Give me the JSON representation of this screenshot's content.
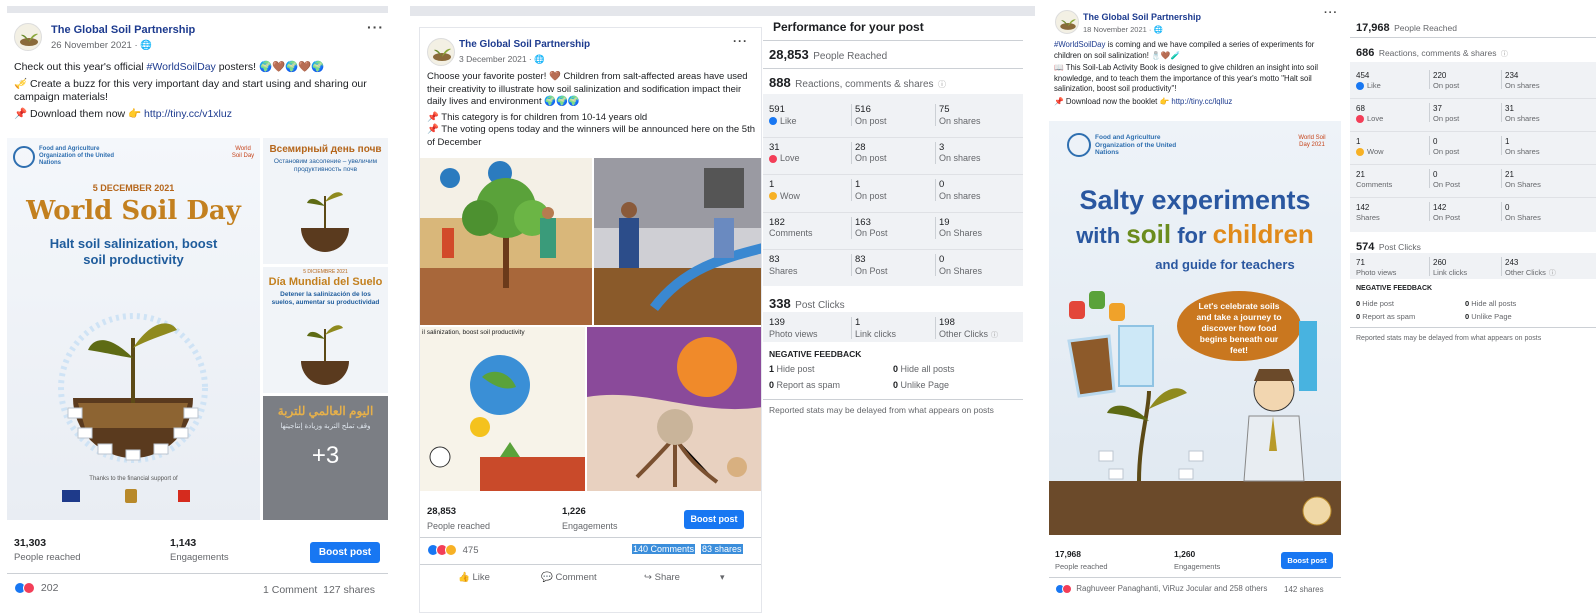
{
  "post1": {
    "page_name": "The Global Soil Partnership",
    "date": "26 November 2021 · ",
    "line1a": "Check out this year's official ",
    "line1b": "#WorldSoilDay",
    "line1c": " posters! 🌍🤎🌍🤎🌍",
    "line2": "🎺 Create a buzz for this very important day and start using and sharing our campaign materials!",
    "line3a": "📌 Download them now 👉 ",
    "line3b": "http://tiny.cc/v1xluz",
    "poster_main": {
      "org": "Food and Agriculture Organization of the United Nations",
      "date": "5 DECEMBER 2021",
      "title": "World Soil Day",
      "subtitle": "Halt soil salinization, boost soil productivity",
      "badge": "World Soil Day",
      "footer": "Thanks to the financial support of"
    },
    "poster_ru": {
      "title": "Всемирный день почв",
      "sub": "Остановим засоление – увеличим продуктивность почв"
    },
    "poster_es": {
      "date": "5 DICIEMBRE 2021",
      "title": "Día Mundial del Suelo",
      "sub": "Detener la salinización de los suelos, aumentar su productividad"
    },
    "poster_ar": {
      "title": "اليوم العالمي للتربة",
      "sub": "وقف تملح التربة وزيادة إنتاجيتها",
      "more": "+3"
    },
    "reached_num": "31,303",
    "reached_lab": "People reached",
    "eng_num": "1,143",
    "eng_lab": "Engagements",
    "boost": "Boost post",
    "reactions": "202",
    "comments_shares": "1 Comment  127 shares"
  },
  "post2": {
    "page_name": "The Global Soil Partnership",
    "date": "3 December 2021 · ",
    "line1": "Choose your favorite poster! 🤎 Children from salt-affected areas have used their creativity to illustrate how soil salinization and sodification impact their daily lives and environment 🌍🌍🌍",
    "line2": "📌 This category is for children from 10-14 years old",
    "line3": "📌 The voting opens today and the winners will be announced here on the 5th of December",
    "drawing_text": "il salinization, boost soil productivity",
    "reached_num": "28,853",
    "reached_lab": "People reached",
    "eng_num": "1,226",
    "eng_lab": "Engagements",
    "boost": "Boost post",
    "reactions": "475",
    "comments": "140 Comments",
    "shares": "83 shares",
    "like": "Like",
    "comment": "Comment",
    "share": "Share"
  },
  "perf2": {
    "title": "Performance for your post",
    "reached_num": "28,853",
    "reached_lab": "People Reached",
    "rcs_num": "888",
    "rcs_lab": "Reactions, comments & shares",
    "rows": [
      {
        "a_n": "591",
        "a_l": "Like",
        "b_n": "516",
        "b_l": "On post",
        "c_n": "75",
        "c_l": "On shares"
      },
      {
        "a_n": "31",
        "a_l": "Love",
        "b_n": "28",
        "b_l": "On post",
        "c_n": "3",
        "c_l": "On shares"
      },
      {
        "a_n": "1",
        "a_l": "Wow",
        "b_n": "1",
        "b_l": "On post",
        "c_n": "0",
        "c_l": "On shares"
      },
      {
        "a_n": "182",
        "a_l": "Comments",
        "b_n": "163",
        "b_l": "On Post",
        "c_n": "19",
        "c_l": "On Shares"
      },
      {
        "a_n": "83",
        "a_l": "Shares",
        "b_n": "83",
        "b_l": "On Post",
        "c_n": "0",
        "c_l": "On Shares"
      }
    ],
    "clicks_num": "338",
    "clicks_lab": "Post Clicks",
    "clicks": [
      {
        "n": "139",
        "l": "Photo views"
      },
      {
        "n": "1",
        "l": "Link clicks"
      },
      {
        "n": "198",
        "l": "Other Clicks"
      }
    ],
    "neg_title": "NEGATIVE FEEDBACK",
    "neg": [
      {
        "n": "1",
        "l": "Hide post"
      },
      {
        "n": "0",
        "l": "Hide all posts"
      },
      {
        "n": "0",
        "l": "Report as spam"
      },
      {
        "n": "0",
        "l": "Unlike Page"
      }
    ],
    "note": "Reported stats may be delayed from what appears on posts"
  },
  "post3": {
    "page_name": "The Global Soil Partnership",
    "date": "18 November 2021 · ",
    "line1a": "#WorldSoilDay",
    "line1b": " is coming and we have compiled a series of experiments for children on soil salinization! 🧂🤎🧪",
    "line2": "📖 This Soil-Lab Activity Book is designed to give children an insight into soil knowledge, and to teach them the importance of this year's motto \"Halt soil salinization, boost soil productivity\"!",
    "line3a": "📌 Download now the booklet 👉 ",
    "line3b": "http://tiny.cc/lqlluz",
    "poster": {
      "org": "Food and Agriculture Organization of the United Nations",
      "badge": "World Soil Day 2021",
      "t1": "Salty experiments",
      "t2a": "with ",
      "t2b": "soil",
      "t2c": " for ",
      "t2d": "children",
      "t3": "and guide for teachers",
      "bubble": "Let's celebrate soils and take a journey to discover how food begins beneath our feet!"
    },
    "reached_num": "17,968",
    "reached_lab": "People reached",
    "eng_num": "1,260",
    "eng_lab": "Engagements",
    "boost": "Boost post",
    "reactions": "Raghuveer Panaghanti, ViRuz Jocular and 258 others",
    "shares": "142 shares"
  },
  "perf3": {
    "reached_num": "17,968",
    "reached_lab": "People Reached",
    "rcs_num": "686",
    "rcs_lab": "Reactions, comments & shares",
    "rows": [
      {
        "a_n": "454",
        "a_l": "Like",
        "b_n": "220",
        "b_l": "On post",
        "c_n": "234",
        "c_l": "On shares"
      },
      {
        "a_n": "68",
        "a_l": "Love",
        "b_n": "37",
        "b_l": "On post",
        "c_n": "31",
        "c_l": "On shares"
      },
      {
        "a_n": "1",
        "a_l": "Wow",
        "b_n": "0",
        "b_l": "On post",
        "c_n": "1",
        "c_l": "On shares"
      },
      {
        "a_n": "21",
        "a_l": "Comments",
        "b_n": "0",
        "b_l": "On Post",
        "c_n": "21",
        "c_l": "On Shares"
      },
      {
        "a_n": "142",
        "a_l": "Shares",
        "b_n": "142",
        "b_l": "On Post",
        "c_n": "0",
        "c_l": "On Shares"
      }
    ],
    "clicks_num": "574",
    "clicks_lab": "Post Clicks",
    "clicks": [
      {
        "n": "71",
        "l": "Photo views"
      },
      {
        "n": "260",
        "l": "Link clicks"
      },
      {
        "n": "243",
        "l": "Other Clicks"
      }
    ],
    "neg_title": "NEGATIVE FEEDBACK",
    "neg": [
      {
        "n": "0",
        "l": "Hide post"
      },
      {
        "n": "0",
        "l": "Hide all posts"
      },
      {
        "n": "0",
        "l": "Report as spam"
      },
      {
        "n": "0",
        "l": "Unlike Page"
      }
    ],
    "note": "Reported stats may be delayed from what appears on posts"
  },
  "icons": [
    "globe-icon",
    "like-icon",
    "love-icon",
    "wow-icon",
    "comment-icon",
    "share-icon",
    "info-icon",
    "more-options-icon"
  ],
  "colors": {
    "brand": "#1877f2",
    "link": "#1d3b8f",
    "grey": "#f0f2f5"
  }
}
